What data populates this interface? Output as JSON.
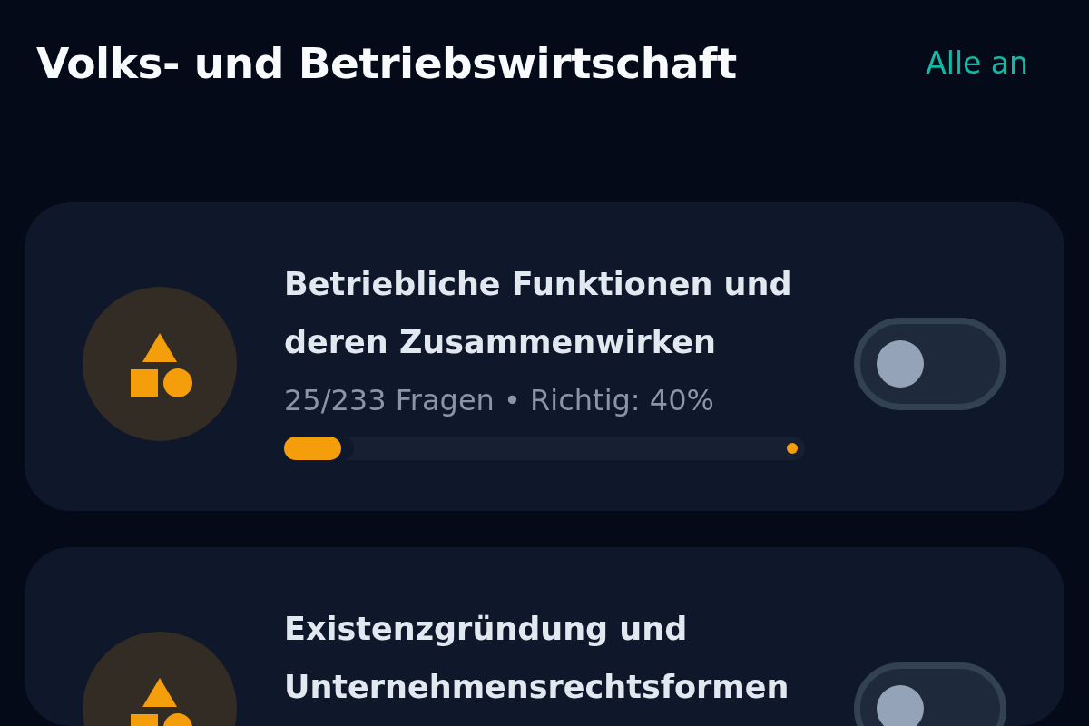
{
  "header": {
    "title": "Volks- und Betriebswirtschaft",
    "action": "Alle an"
  },
  "topics": [
    {
      "title": "Betriebliche Funktionen und deren Zusammenwirken",
      "stats": "25/233 Fragen • Richtig: 40%",
      "level": 0.11,
      "on": false
    },
    {
      "title": "Existenzgründung und Unternehmensrechtsformen",
      "on": false
    }
  ]
}
